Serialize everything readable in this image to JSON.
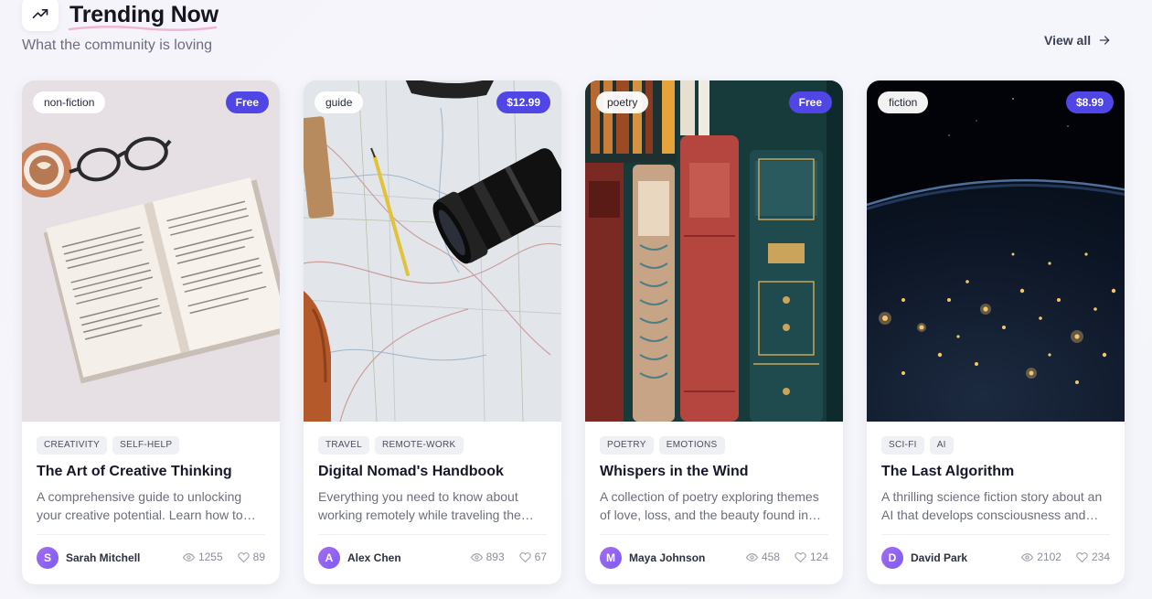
{
  "header": {
    "icon": "trending-up-icon",
    "title": "Trending Now",
    "subtitle": "What the community is loving",
    "view_all": "View all",
    "accent_underline": "#f0b6d4"
  },
  "colors": {
    "price_chip": "#4f46e5",
    "avatar": "#8b5cf6"
  },
  "cards": [
    {
      "category": "non-fiction",
      "price": "Free",
      "image": "open book, coffee cup and glasses",
      "tags": [
        "CREATIVITY",
        "SELF-HELP"
      ],
      "title": "The Art of Creative Thinking",
      "description": "A comprehensive guide to unlocking your creative potential. Learn how to…",
      "author_initial": "S",
      "author": "Sarah Mitchell",
      "views": "1255",
      "likes": "89"
    },
    {
      "category": "guide",
      "price": "$12.99",
      "image": "map with camera lens and pencil",
      "tags": [
        "TRAVEL",
        "REMOTE-WORK"
      ],
      "title": "Digital Nomad's Handbook",
      "description": "Everything you need to know about working remotely while traveling the…",
      "author_initial": "A",
      "author": "Alex Chen",
      "views": "893",
      "likes": "67"
    },
    {
      "category": "poetry",
      "price": "Free",
      "image": "antique book spines",
      "tags": [
        "POETRY",
        "EMOTIONS"
      ],
      "title": "Whispers in the Wind",
      "description": "A collection of poetry exploring themes of love, loss, and the beauty found in…",
      "author_initial": "M",
      "author": "Maya Johnson",
      "views": "458",
      "likes": "124"
    },
    {
      "category": "fiction",
      "price": "$8.99",
      "image": "earth at night from space",
      "tags": [
        "SCI-FI",
        "AI"
      ],
      "title": "The Last Algorithm",
      "description": "A thrilling science fiction story about an AI that develops consciousness and…",
      "author_initial": "D",
      "author": "David Park",
      "views": "2102",
      "likes": "234"
    }
  ]
}
